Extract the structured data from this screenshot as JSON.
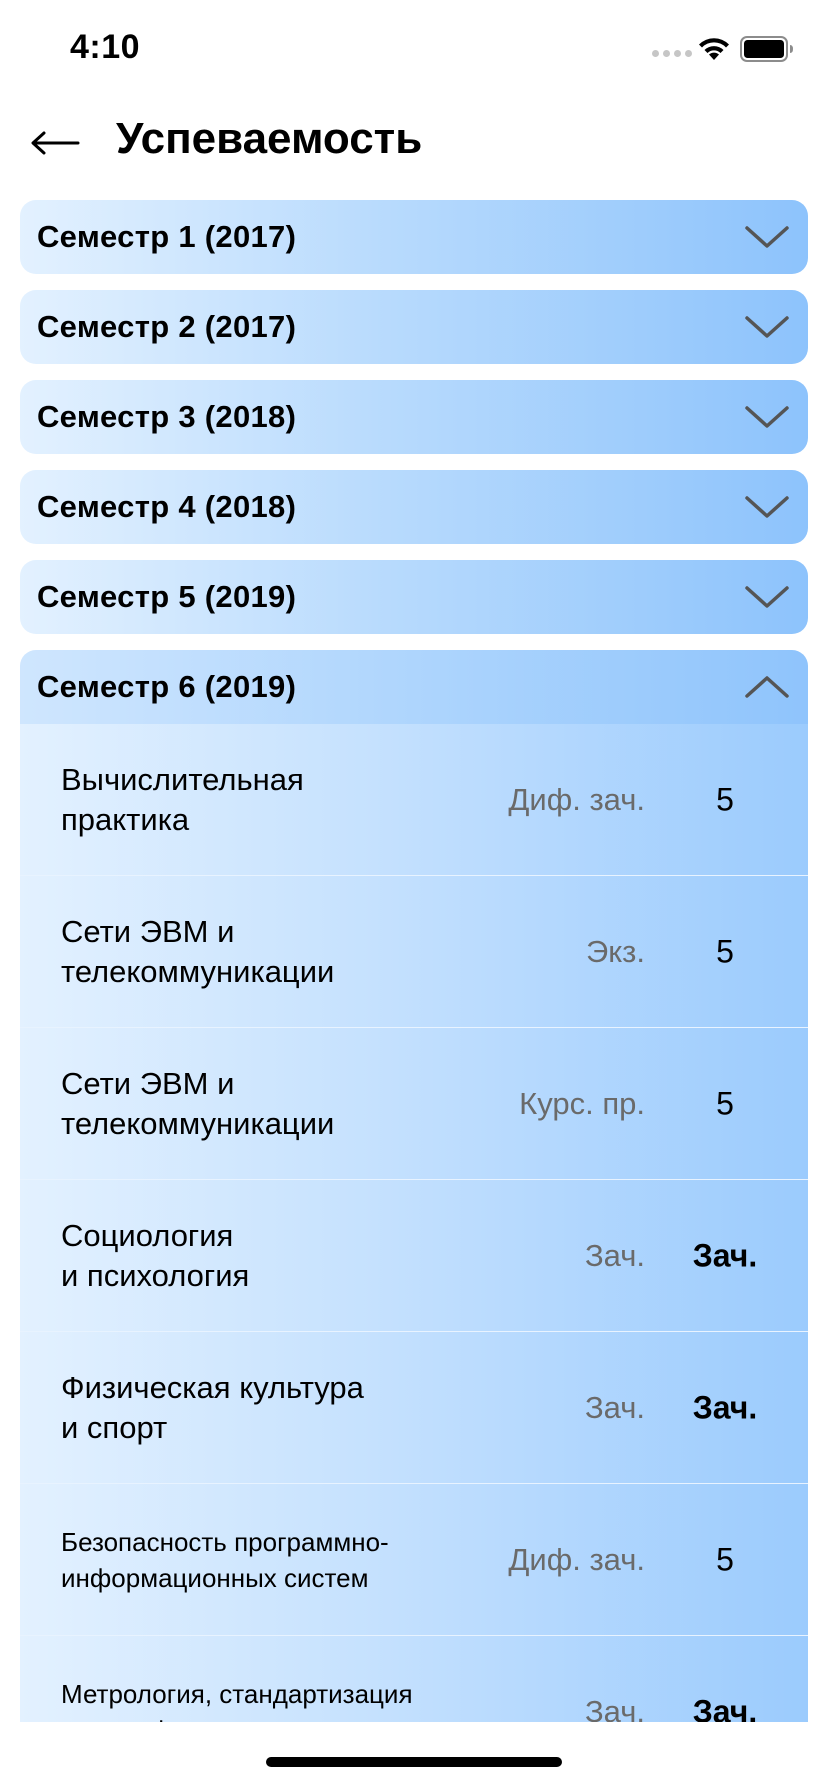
{
  "status_bar": {
    "time": "4:10"
  },
  "header": {
    "title": "Успеваемость"
  },
  "semesters": [
    {
      "label": "Семестр 1 (2017)",
      "expanded": false
    },
    {
      "label": "Семестр 2 (2017)",
      "expanded": false
    },
    {
      "label": "Семестр 3 (2018)",
      "expanded": false
    },
    {
      "label": "Семестр 4 (2018)",
      "expanded": false
    },
    {
      "label": "Семестр 5 (2019)",
      "expanded": false
    },
    {
      "label": "Семестр 6 (2019)",
      "expanded": true
    }
  ],
  "subjects": [
    {
      "name": "Вычислительная\nпрактика",
      "type": "Диф. зач.",
      "grade": "5"
    },
    {
      "name": "Сети ЭВМ и\nтелекоммуникации",
      "type": "Экз.",
      "grade": "5"
    },
    {
      "name": "Сети ЭВМ и\nтелекоммуникации",
      "type": "Курс. пр.",
      "grade": "5"
    },
    {
      "name": "Социология\nи психология",
      "type": "Зач.",
      "grade": "Зач."
    },
    {
      "name": "Физическая культура\nи спорт",
      "type": "Зач.",
      "grade": "Зач."
    },
    {
      "name": "Безопасность программно-\nинформационных систем",
      "type": "Диф. зач.",
      "grade": "5"
    },
    {
      "name": "Метрология, стандартизация\nи сертификация",
      "type": "Зач.",
      "grade": "Зач."
    }
  ],
  "colors": {
    "accent_light": "#e3f1ff",
    "accent_dark": "#8dc3fc",
    "secondary_text": "#6a6a6a"
  },
  "icons": {
    "back": "arrow-left-icon",
    "collapsed": "chevron-down-icon",
    "expanded": "chevron-up-icon"
  }
}
